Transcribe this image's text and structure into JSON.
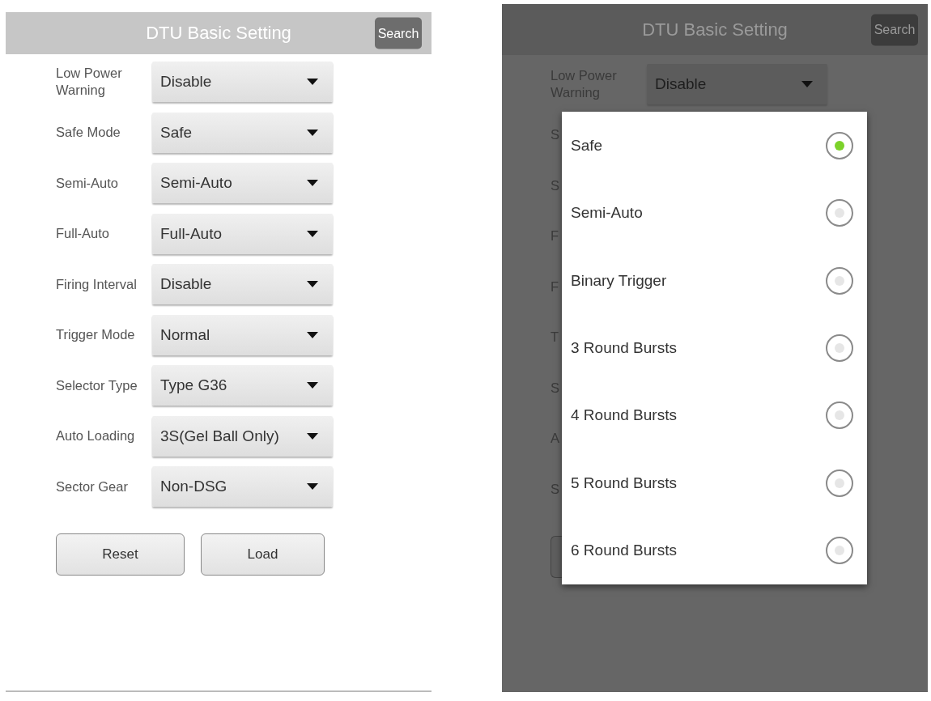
{
  "screens": [
    {
      "dimmed": false,
      "title": "DTU Basic Setting",
      "search_button": "Search",
      "rows": [
        {
          "label": "Low Power Warning",
          "value": "Disable"
        },
        {
          "label": "Safe Mode",
          "value": "Safe"
        },
        {
          "label": "Semi-Auto",
          "value": "Semi-Auto"
        },
        {
          "label": "Full-Auto",
          "value": "Full-Auto"
        },
        {
          "label": "Firing Interval",
          "value": "Disable"
        },
        {
          "label": "Trigger Mode",
          "value": "Normal"
        },
        {
          "label": "Selector Type",
          "value": "Type G36"
        },
        {
          "label": "Auto Loading",
          "value": "3S(Gel Ball Only)"
        },
        {
          "label": "Sector Gear",
          "value": "Non-DSG"
        }
      ],
      "buttons": [
        "Reset",
        "Load"
      ]
    },
    {
      "dimmed": true,
      "title": "DTU Basic Setting",
      "search_button": "Search",
      "rows": [
        {
          "label": "Low Power Warning",
          "value": "Disable"
        },
        {
          "label": "S"
        },
        {
          "label": "S"
        },
        {
          "label": "F"
        },
        {
          "label": "F"
        },
        {
          "label": "T"
        },
        {
          "label": "S"
        },
        {
          "label": "A"
        },
        {
          "label": "S"
        }
      ],
      "partial_button": true,
      "dialog": {
        "options": [
          {
            "label": "Safe",
            "selected": true
          },
          {
            "label": "Semi-Auto",
            "selected": false
          },
          {
            "label": "Binary Trigger",
            "selected": false
          },
          {
            "label": "3 Round Bursts",
            "selected": false
          },
          {
            "label": "4 Round Bursts",
            "selected": false
          },
          {
            "label": "5 Round Bursts",
            "selected": false
          },
          {
            "label": "6 Round Bursts",
            "selected": false
          }
        ]
      }
    }
  ]
}
